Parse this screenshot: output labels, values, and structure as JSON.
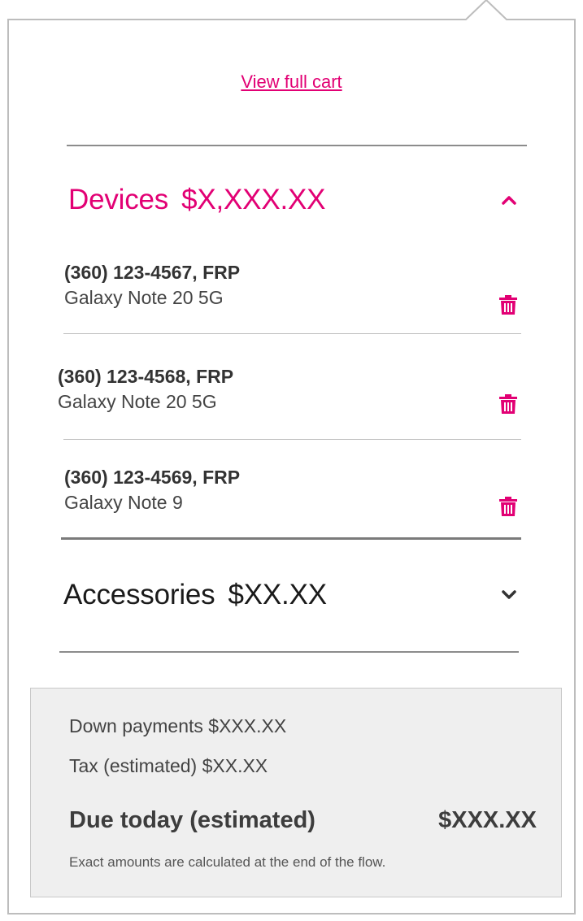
{
  "cart_link": {
    "label": "View full cart"
  },
  "devices_section": {
    "title": "Devices",
    "amount": "$X,XXX.XX",
    "expanded": true,
    "items": [
      {
        "line_number": "(360) 123-4567, FRP",
        "model": "Galaxy Note 20 5G",
        "icon": "trash-icon"
      },
      {
        "line_number": "(360) 123-4568, FRP",
        "model": "Galaxy Note 20 5G",
        "icon": "trash-icon"
      },
      {
        "line_number": "(360) 123-4569, FRP",
        "model": "Galaxy Note 9",
        "icon": "trash-icon"
      }
    ]
  },
  "accessories_section": {
    "title": "Accessories",
    "amount": "$XX.XX",
    "expanded": false
  },
  "summary": {
    "down_payments": "Down payments $XXX.XX",
    "tax": "Tax (estimated) $XX.XX",
    "due_label": "Due today (estimated)",
    "due_amount": "$XXX.XX",
    "note": "Exact amounts are calculated at the end of the flow."
  },
  "colors": {
    "accent": "#e20074",
    "summary_bg": "#efefef",
    "divider": "#8c8c8c"
  }
}
